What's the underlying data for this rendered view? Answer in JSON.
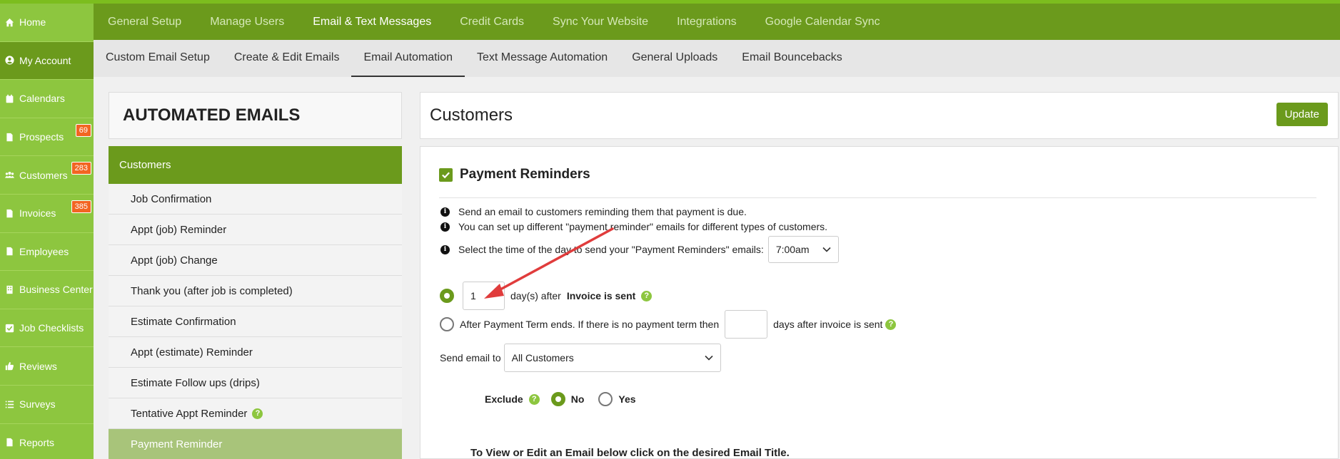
{
  "sidebar": {
    "items": [
      {
        "label": "Home",
        "icon": "home-icon"
      },
      {
        "label": "My Account",
        "icon": "user-circle-icon"
      },
      {
        "label": "Calendars",
        "icon": "calendar-icon"
      },
      {
        "label": "Prospects",
        "icon": "document-icon",
        "badge": "69"
      },
      {
        "label": "Customers",
        "icon": "users-icon",
        "badge": "283"
      },
      {
        "label": "Invoices",
        "icon": "document-icon",
        "badge": "385"
      },
      {
        "label": "Employees",
        "icon": "document-icon"
      },
      {
        "label": "Business Center",
        "icon": "building-icon"
      },
      {
        "label": "Job Checklists",
        "icon": "checkbox-icon"
      },
      {
        "label": "Reviews",
        "icon": "thumbs-up-icon"
      },
      {
        "label": "Surveys",
        "icon": "list-icon"
      },
      {
        "label": "Reports",
        "icon": "document-icon"
      }
    ]
  },
  "topnav": {
    "tabs": [
      "General Setup",
      "Manage Users",
      "Email & Text Messages",
      "Credit Cards",
      "Sync Your Website",
      "Integrations",
      "Google Calendar Sync"
    ]
  },
  "subnav": {
    "tabs": [
      "Custom Email Setup",
      "Create & Edit Emails",
      "Email Automation",
      "Text Message Automation",
      "General Uploads",
      "Email Bouncebacks"
    ]
  },
  "left_panel": {
    "title": "AUTOMATED EMAILS",
    "category": "Customers",
    "items": [
      "Job Confirmation",
      "Appt (job) Reminder",
      "Appt (job) Change",
      "Thank you (after job is completed)",
      "Estimate Confirmation",
      "Appt (estimate) Reminder",
      "Estimate Follow ups (drips)",
      "Tentative Appt Reminder",
      "Payment Reminder"
    ]
  },
  "content": {
    "title": "Customers",
    "update_label": "Update",
    "section_title": "Payment Reminders",
    "info_lines": [
      "Send an email to customers reminding them that payment is due.",
      "You can set up different \"payment reminder\" emails for different types of customers.",
      "Select the time of the day to send your \"Payment Reminders\" emails:"
    ],
    "time_value": "7:00am",
    "option1": {
      "days_value": "1",
      "text": "day(s) after",
      "bold_text": "Invoice is sent"
    },
    "option2": {
      "text_before": "After Payment Term ends. If there is no payment term then",
      "days_value": "",
      "text_after": "days after invoice is sent"
    },
    "send_to_label": "Send email to",
    "send_to_value": "All Customers",
    "exclude_label": "Exclude",
    "exclude_no": "No",
    "exclude_yes": "Yes",
    "footer_text": "To View or Edit an Email below click on the desired Email Title."
  },
  "colors": {
    "sidebar_green": "#8dc63f",
    "dark_green": "#6b9a1c",
    "badge_orange": "#f26522",
    "annotation_red": "#e03c3c"
  }
}
